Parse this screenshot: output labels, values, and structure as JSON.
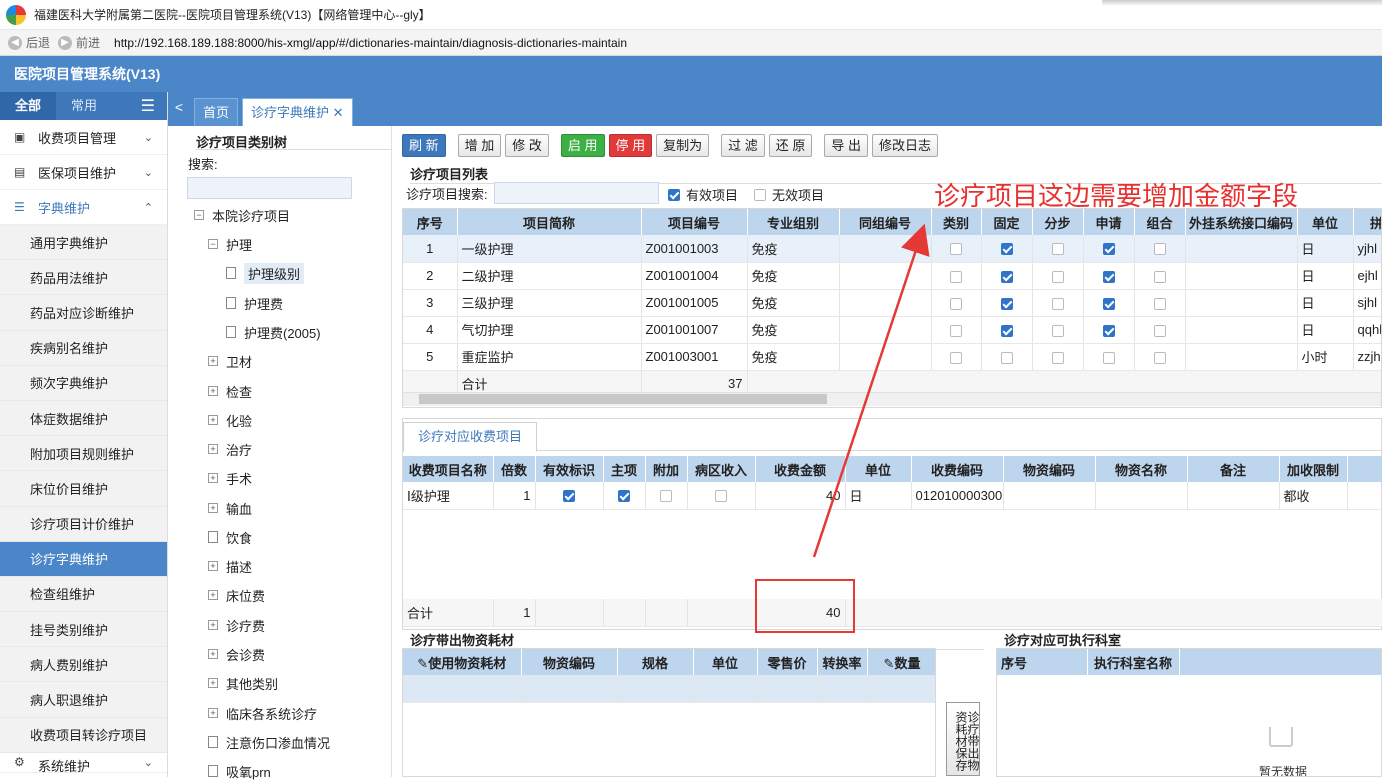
{
  "window": {
    "title": "福建医科大学附属第二医院--医院项目管理系统(V13)【网络管理中心--gly】"
  },
  "browser": {
    "back": "后退",
    "forward": "前进",
    "url": "http://192.168.189.188:8000/his-xmgl/app/#/dictionaries-maintain/diagnosis-dictionaries-maintain"
  },
  "app": {
    "title": "医院项目管理系统(V13)"
  },
  "sidebar": {
    "tab_all": "全部",
    "tab_common": "常用",
    "groups": [
      {
        "label": "收费项目管理",
        "icon": "ledger-icon"
      },
      {
        "label": "医保项目维护",
        "icon": "card-icon"
      },
      {
        "label": "字典维护",
        "icon": "list-icon"
      }
    ],
    "sub_items": [
      "通用字典维护",
      "药品用法维护",
      "药品对应诊断维护",
      "疾病别名维护",
      "频次字典维护",
      "体症数据维护",
      "附加项目规则维护",
      "床位价目维护",
      "诊疗项目计价维护",
      "诊疗字典维护",
      "检查组维护",
      "挂号类别维护",
      "病人费别维护",
      "病人职退维护",
      "收费项目转诊疗项目"
    ],
    "bottom_group": "系统维护"
  },
  "tabs": {
    "home": "首页",
    "active": "诊疗字典维护"
  },
  "tree": {
    "title": "诊疗项目类别树",
    "search_label": "搜索:",
    "root": "本院诊疗项目",
    "nursing": "护理",
    "nursing_children": [
      "护理级别",
      "护理费",
      "护理费(2005)"
    ],
    "others": [
      "卫材",
      "检查",
      "化验",
      "治疗",
      "手术",
      "输血",
      "饮食",
      "描述",
      "床位费",
      "诊疗费",
      "会诊费",
      "其他类别",
      "临床各系统诊疗",
      "注意伤口渗血情况",
      "吸氧prn"
    ]
  },
  "toolbar": {
    "refresh": "刷 新",
    "add": "增 加",
    "edit": "修 改",
    "enable": "启 用",
    "disable": "停 用",
    "copy": "复制为",
    "filter": "过 滤",
    "restore": "还 原",
    "export": "导 出",
    "log": "修改日志"
  },
  "list": {
    "title": "诊疗项目列表",
    "search_label": "诊疗项目搜索:",
    "valid": "有效项目",
    "invalid": "无效项目",
    "columns": [
      "序号",
      "项目简称",
      "项目编号",
      "专业组别",
      "同组编号",
      "类别",
      "固定",
      "分步",
      "申请",
      "组合",
      "外挂系统接口编码",
      "单位",
      "拼音"
    ],
    "rows": [
      {
        "no": "1",
        "name": "一级护理",
        "code": "Z001001003",
        "group": "免疫",
        "unit": "日",
        "py": "yjhl",
        "fixed": true,
        "apply": true
      },
      {
        "no": "2",
        "name": "二级护理",
        "code": "Z001001004",
        "group": "免疫",
        "unit": "日",
        "py": "ejhl",
        "fixed": true,
        "apply": true
      },
      {
        "no": "3",
        "name": "三级护理",
        "code": "Z001001005",
        "group": "免疫",
        "unit": "日",
        "py": "sjhl",
        "fixed": true,
        "apply": true
      },
      {
        "no": "4",
        "name": "气切护理",
        "code": "Z001001007",
        "group": "免疫",
        "unit": "日",
        "py": "qqhl",
        "fixed": true,
        "apply": true
      },
      {
        "no": "5",
        "name": "重症监护",
        "code": "Z001003001",
        "group": "免疫",
        "unit": "小时",
        "py": "zzjh",
        "fixed": false,
        "apply": false
      }
    ],
    "total_label": "合计",
    "total_count": "37"
  },
  "annotation": "诊疗项目这边需要增加金额字段",
  "charge": {
    "tab": "诊疗对应收费项目",
    "columns": [
      "收费项目名称",
      "倍数",
      "有效标识",
      "主项",
      "附加",
      "病区收入",
      "收费金额",
      "单位",
      "收费编码",
      "物资编码",
      "物资名称",
      "备注",
      "加收限制"
    ],
    "row": {
      "name": "Ⅰ级护理",
      "mult": "1",
      "amount": "40",
      "unit": "日",
      "code": "012010000300",
      "limit": "都收"
    },
    "total_label": "合计",
    "total_mult": "1",
    "total_amount": "40"
  },
  "materials": {
    "title": "诊疗带出物资耗材",
    "columns": [
      "使用物资耗材",
      "物资编码",
      "规格",
      "单位",
      "零售价",
      "转换率",
      "数量"
    ],
    "save": "诊疗带出物资耗材保存"
  },
  "depts": {
    "title": "诊疗对应可执行科室",
    "columns": [
      "序号",
      "执行科室名称"
    ],
    "empty": "暂无数据"
  },
  "colors": {
    "accent": "#4a86c8",
    "annotation": "#e8312f"
  }
}
